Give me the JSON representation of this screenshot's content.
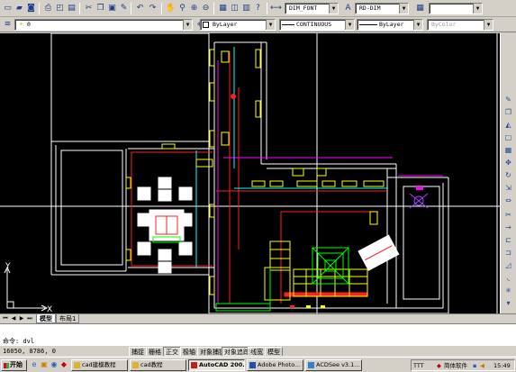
{
  "toolbar_standard": {
    "icons": [
      "new-icon",
      "open-icon",
      "save-icon",
      "print-icon",
      "preview-icon",
      "publish-icon",
      "cut-icon",
      "copy-icon",
      "paste-icon",
      "match-properties-icon",
      "undo-icon",
      "redo-icon",
      "pan-icon",
      "zoom-realtime-icon",
      "zoom-window-icon",
      "zoom-previous-icon",
      "properties-icon",
      "design-center-icon",
      "tool-palettes-icon"
    ],
    "dimstyle_value": "DIM_FONT",
    "textstyle_value": "RD-DIM"
  },
  "toolbar_layers": {
    "layer_value": "0",
    "color_value": "ByLayer",
    "linetype_value": "CONTINUOUS",
    "lineweight_value": "ByLayer",
    "plotstyle_value": "ByColor"
  },
  "drawing": {
    "ucs_x_label": "X",
    "ucs_y_label": "Y",
    "colors": {
      "background": "#000000",
      "walls": "#ffffff",
      "accent_red": "#ff2020",
      "accent_yellow": "#ffff00",
      "accent_green": "#00ff00",
      "accent_cyan": "#00ffff",
      "accent_magenta": "#ff00ff"
    }
  },
  "layout_tabs": {
    "model_tab": "模型",
    "layout_tab": "布局1"
  },
  "command_line": {
    "prompt": "命令: dvl"
  },
  "statusbar": {
    "coordinates": "16050, 8786, 0",
    "toggles": [
      {
        "label": "捕捉",
        "on": false
      },
      {
        "label": "栅格",
        "on": false
      },
      {
        "label": "正交",
        "on": true
      },
      {
        "label": "极轴",
        "on": false
      },
      {
        "label": "对象捕捉",
        "on": false
      },
      {
        "label": "对象追踪",
        "on": true
      },
      {
        "label": "线宽",
        "on": false
      },
      {
        "label": "模型",
        "on": false
      }
    ]
  },
  "taskbar": {
    "start_label": "开始",
    "tasks": [
      {
        "label": "cad建模教程",
        "active": false
      },
      {
        "label": "cad教程",
        "active": false
      },
      {
        "label": "AutoCAD 200...",
        "active": true
      },
      {
        "label": "Adobe Photo...",
        "active": false
      },
      {
        "label": "ACDSee v3.1...",
        "active": false
      }
    ],
    "tray": {
      "ime": "TTT",
      "ime_label": "简体软件",
      "clock": "15:49"
    }
  }
}
